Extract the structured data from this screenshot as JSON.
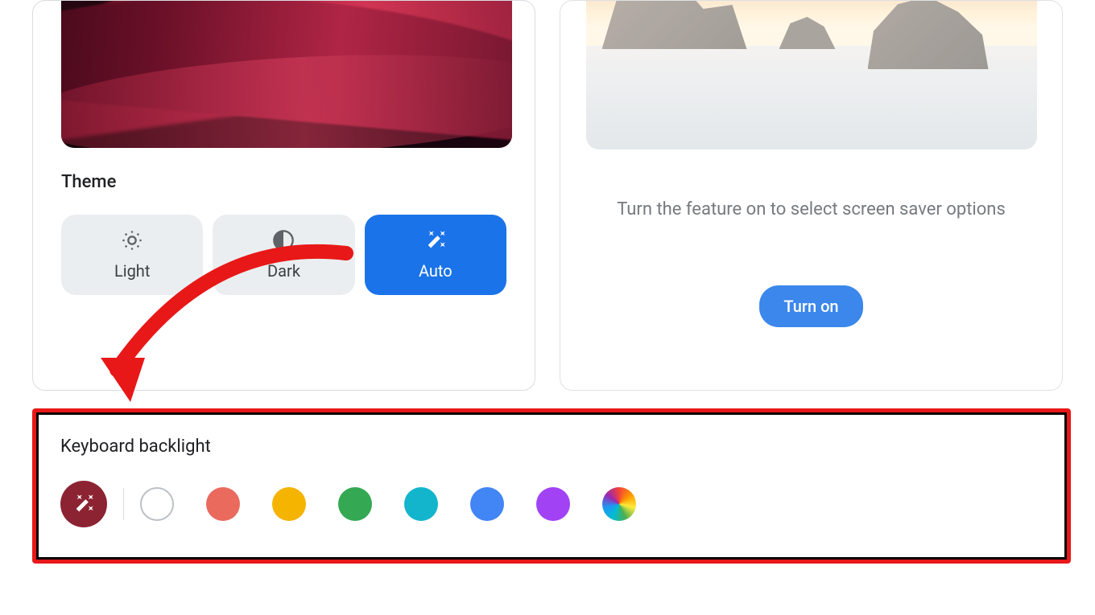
{
  "theme": {
    "title": "Theme",
    "options": {
      "light": "Light",
      "dark": "Dark",
      "auto": "Auto"
    },
    "selected": "auto"
  },
  "screensaver": {
    "description": "Turn the feature on to select screen saver options",
    "button": "Turn on"
  },
  "keyboard_backlight": {
    "title": "Keyboard backlight",
    "selected": "auto",
    "swatches": [
      {
        "name": "auto",
        "color": "#8c2332"
      },
      {
        "name": "white",
        "color": "#ffffff"
      },
      {
        "name": "red",
        "color": "#ea6a5e"
      },
      {
        "name": "yellow",
        "color": "#f4b400"
      },
      {
        "name": "green",
        "color": "#34a853"
      },
      {
        "name": "teal",
        "color": "#12b5cb"
      },
      {
        "name": "blue",
        "color": "#4285f4"
      },
      {
        "name": "purple",
        "color": "#a142f4"
      },
      {
        "name": "rainbow",
        "color": "rainbow"
      }
    ]
  },
  "annotation": {
    "arrow_color": "#e81818",
    "highlight_box_color": "#e81818"
  }
}
